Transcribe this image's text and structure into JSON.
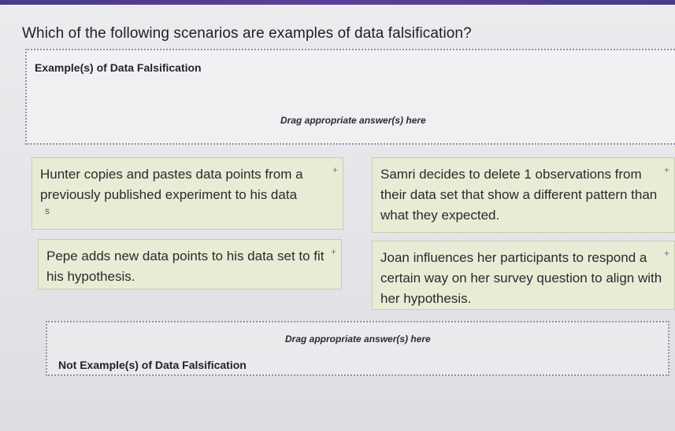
{
  "question": "Which of the following scenarios are examples of data falsification?",
  "zones": [
    {
      "title": "Example(s) of Data Falsification",
      "hint": "Drag appropriate answer(s) here"
    },
    {
      "title": "Not Example(s) of Data Falsification",
      "hint": "Drag appropriate answer(s) here"
    }
  ],
  "cards": [
    {
      "text": "Hunter copies and pastes data points from a previously published experiment to his data",
      "extra": "s",
      "plus": "+"
    },
    {
      "text": "Samri decides to delete 1 observations from their data set that show a different pattern than what they expected.",
      "plus": "+"
    },
    {
      "text": "Pepe adds new data points to his data set to fit his hypothesis.",
      "plus": "+"
    },
    {
      "text": "Joan influences her participants to respond a certain way on her survey question to align with her hypothesis.",
      "plus": "+"
    }
  ]
}
